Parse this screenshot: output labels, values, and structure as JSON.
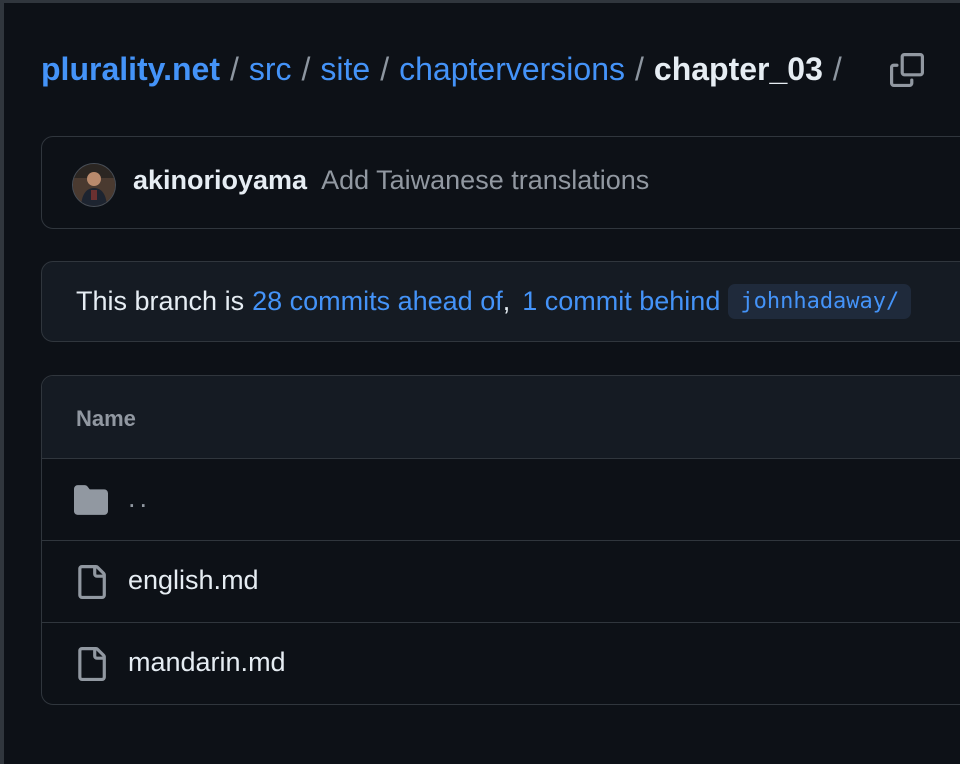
{
  "breadcrumb": {
    "items": [
      "plurality.net",
      "src",
      "site",
      "chapterversions"
    ],
    "current": "chapter_03",
    "separator": "/",
    "trailing_separator": "/"
  },
  "commit": {
    "author": "akinorioyama",
    "message": "Add Taiwanese translations"
  },
  "branch": {
    "prefix": "This branch is",
    "ahead": "28 commits ahead of",
    "comma": ",",
    "behind": "1 commit behind",
    "upstream": "johnhadaway/"
  },
  "files": {
    "header": "Name",
    "rows": [
      {
        "name": "..",
        "icon": "folder-icon"
      },
      {
        "name": "english.md",
        "icon": "file-icon"
      },
      {
        "name": "mandarin.md",
        "icon": "file-icon"
      }
    ]
  },
  "colors": {
    "background": "#0d1117",
    "link": "#4493f8",
    "border": "#30363d",
    "muted": "#9198a1"
  }
}
